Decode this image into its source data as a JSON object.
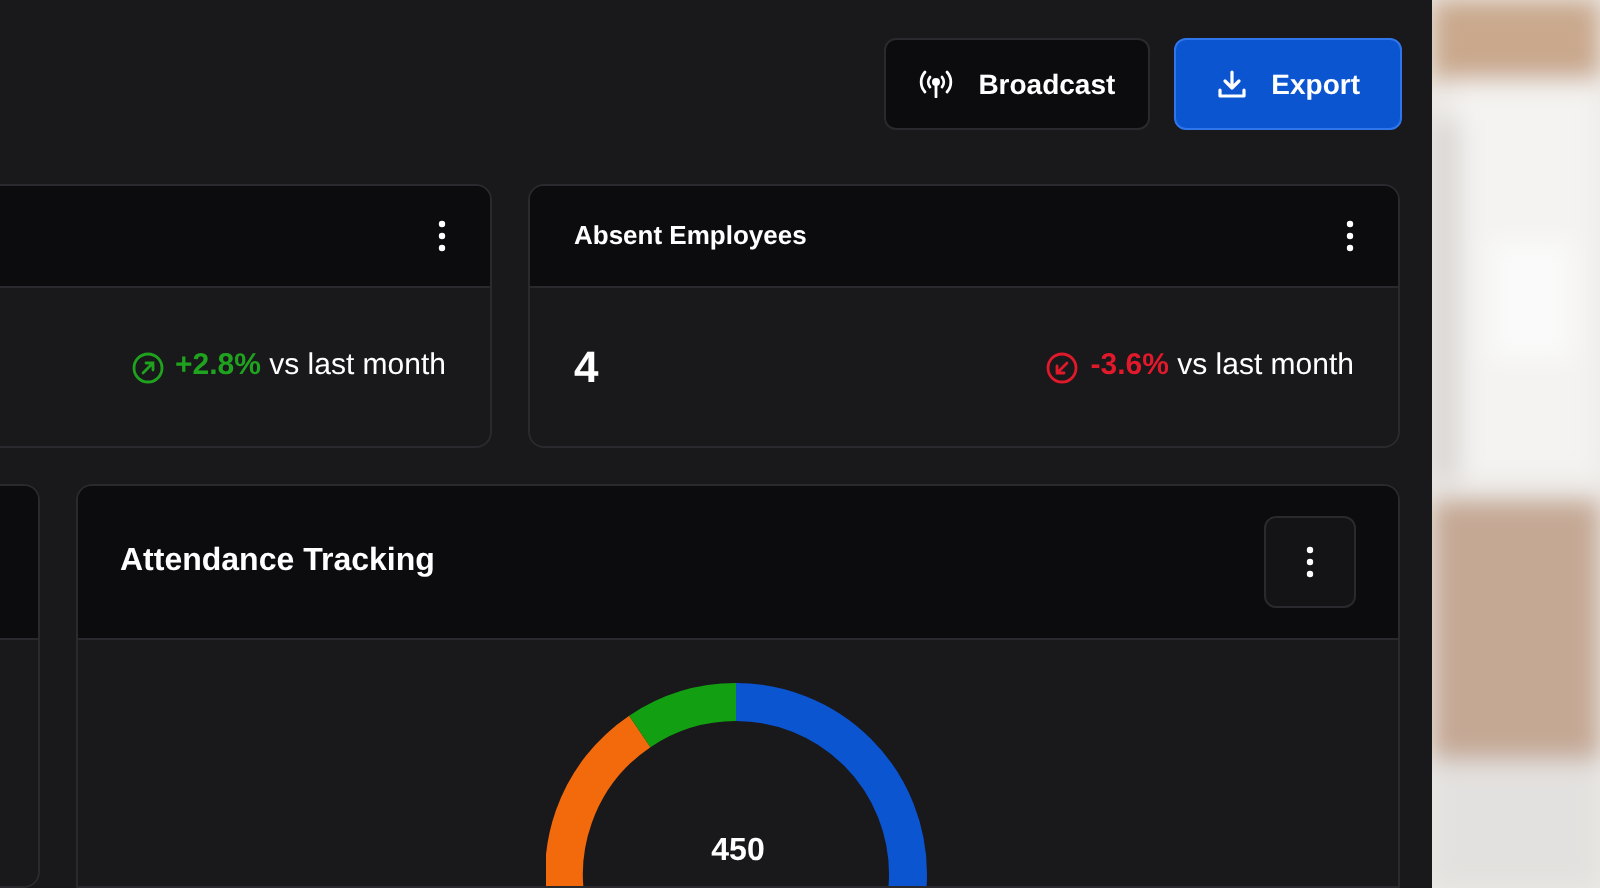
{
  "header_buttons": [
    {
      "kind": "broadcast",
      "label": "Broadcast"
    },
    {
      "kind": "export",
      "label": "Export"
    }
  ],
  "stat_cards": [
    {
      "change": "+2.8%",
      "kind": "up",
      "comparison": "vs last month"
    },
    {
      "title": "Absent Employees",
      "value": "4",
      "change": "-3.6%",
      "kind": "down",
      "comparison": "vs last month"
    }
  ],
  "attendance_card": {
    "title": "Attendance Tracking",
    "total": "450"
  }
}
